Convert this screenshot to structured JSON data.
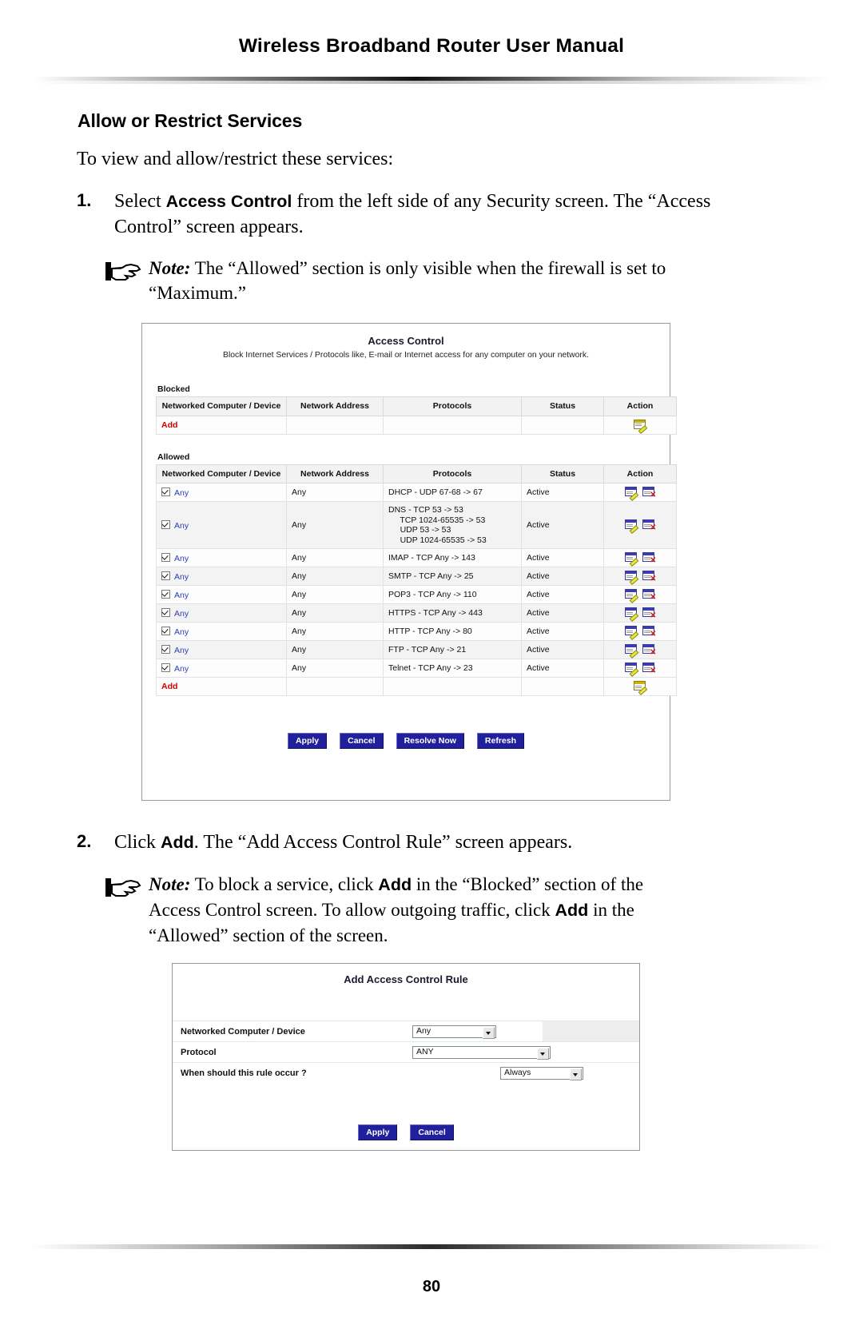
{
  "header": {
    "running_title": "Wireless Broadband Router User Manual"
  },
  "section": {
    "heading": "Allow or Restrict Services",
    "lead": "To view and allow/restrict these services:"
  },
  "steps": [
    {
      "number": "1.",
      "text_before": "Select ",
      "bold": "Access Control",
      "text_after": " from the left side of any Security screen. The “Access Control” screen appears.",
      "note": {
        "label": "Note:",
        "text": " The “Allowed” section is only visible when the firewall is set to “Maximum.”"
      }
    },
    {
      "number": "2.",
      "text_before": "Click ",
      "bold": "Add",
      "text_after": ". The “Add Access Control Rule” screen appears.",
      "note": {
        "label": "Note:",
        "part1": " To block a service, click ",
        "bold1": "Add",
        "part2": " in the “Blocked” section of the Access Control screen. To allow outgoing traffic, click ",
        "bold2": "Add",
        "part3": " in the “Allowed” section of the screen."
      }
    }
  ],
  "figure_access_control": {
    "title": "Access Control",
    "subtitle": "Block Internet Services / Protocols like, E-mail or Internet access for any computer on your network.",
    "blocked": {
      "label": "Blocked",
      "columns": [
        "Networked Computer / Device",
        "Network Address",
        "Protocols",
        "Status",
        "Action"
      ],
      "rows": [
        {
          "device": "Add",
          "address": "",
          "protocols": "",
          "status": "",
          "action": "add-icon",
          "is_add": true
        }
      ]
    },
    "allowed": {
      "label": "Allowed",
      "columns": [
        "Networked Computer / Device",
        "Network Address",
        "Protocols",
        "Status",
        "Action"
      ],
      "rows": [
        {
          "device": "Any",
          "address": "Any",
          "protocols": "DHCP - UDP 67-68 -> 67",
          "status": "Active"
        },
        {
          "device": "Any",
          "address": "Any",
          "protocols": "DNS - TCP 53 -> 53\n     TCP 1024-65535 -> 53\n     UDP 53 -> 53\n     UDP 1024-65535 -> 53",
          "status": "Active"
        },
        {
          "device": "Any",
          "address": "Any",
          "protocols": "IMAP - TCP Any -> 143",
          "status": "Active"
        },
        {
          "device": "Any",
          "address": "Any",
          "protocols": "SMTP - TCP Any -> 25",
          "status": "Active"
        },
        {
          "device": "Any",
          "address": "Any",
          "protocols": "POP3 - TCP Any -> 110",
          "status": "Active"
        },
        {
          "device": "Any",
          "address": "Any",
          "protocols": "HTTPS - TCP Any -> 443",
          "status": "Active"
        },
        {
          "device": "Any",
          "address": "Any",
          "protocols": "HTTP - TCP Any -> 80",
          "status": "Active"
        },
        {
          "device": "Any",
          "address": "Any",
          "protocols": "FTP - TCP Any -> 21",
          "status": "Active"
        },
        {
          "device": "Any",
          "address": "Any",
          "protocols": "Telnet - TCP Any -> 23",
          "status": "Active"
        },
        {
          "device": "Add",
          "address": "",
          "protocols": "",
          "status": "",
          "action": "add-icon",
          "is_add": true
        }
      ]
    },
    "buttons": [
      "Apply",
      "Cancel",
      "Resolve Now",
      "Refresh"
    ]
  },
  "figure_add_rule": {
    "title": "Add Access Control Rule",
    "fields": [
      {
        "label": "Networked Computer / Device",
        "value": "Any"
      },
      {
        "label": "Protocol",
        "value": "ANY"
      },
      {
        "label": "When should this rule occur ?",
        "value": "Always"
      }
    ],
    "buttons": [
      "Apply",
      "Cancel"
    ]
  },
  "footer": {
    "page_number": "80"
  },
  "colors": {
    "link_red": "#cc0000",
    "status_green": "#17a217",
    "checkbox_label_blue": "#2b3fb5",
    "button_blue": "#20209c"
  }
}
